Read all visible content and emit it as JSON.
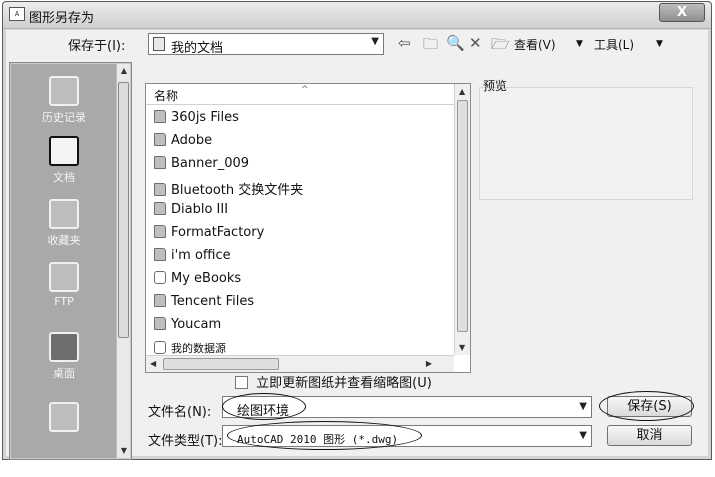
{
  "window": {
    "title": "图形另存为",
    "close_glyph": "X"
  },
  "savein": {
    "label": "保存于(I):",
    "value": "我的文档"
  },
  "toolbar": {
    "view_label": "查看(V)",
    "tools_label": "工具(L)"
  },
  "places": [
    {
      "name": "history",
      "label": "历史记录"
    },
    {
      "name": "documents",
      "label": "文档"
    },
    {
      "name": "favorites",
      "label": "收藏夹"
    },
    {
      "name": "ftp",
      "label": "FTP"
    },
    {
      "name": "desktop",
      "label": "桌面"
    },
    {
      "name": "buzzsaw",
      "label": ""
    }
  ],
  "filelist": {
    "column_name": "名称",
    "items": [
      {
        "name": "360js Files",
        "type": "folder"
      },
      {
        "name": "Adobe",
        "type": "folder"
      },
      {
        "name": "Banner_009",
        "type": "folder"
      },
      {
        "name": "Bluetooth 交换文件夹",
        "type": "folder"
      },
      {
        "name": "Diablo III",
        "type": "folder"
      },
      {
        "name": "FormatFactory",
        "type": "folder"
      },
      {
        "name": "i'm office",
        "type": "folder"
      },
      {
        "name": "My eBooks",
        "type": "special-folder"
      },
      {
        "name": "Tencent Files",
        "type": "folder"
      },
      {
        "name": "Youcam",
        "type": "folder"
      },
      {
        "name": "我的数据源",
        "type": "special-folder"
      }
    ]
  },
  "preview": {
    "label": "预览"
  },
  "update_checkbox": {
    "label": "立即更新图纸并查看缩略图(U)",
    "checked": false
  },
  "filename": {
    "label": "文件名(N):",
    "value": "绘图环境"
  },
  "filetype": {
    "label": "文件类型(T):",
    "value": "AutoCAD 2010 图形 (*.dwg)"
  },
  "buttons": {
    "save": "保存(S)",
    "cancel": "取消"
  },
  "icons": {
    "back": "back-arrow-icon",
    "up": "up-folder-icon",
    "search": "search-web-icon",
    "delete": "delete-icon",
    "newfolder": "new-folder-icon",
    "dropdown": "chevron-down-icon"
  }
}
